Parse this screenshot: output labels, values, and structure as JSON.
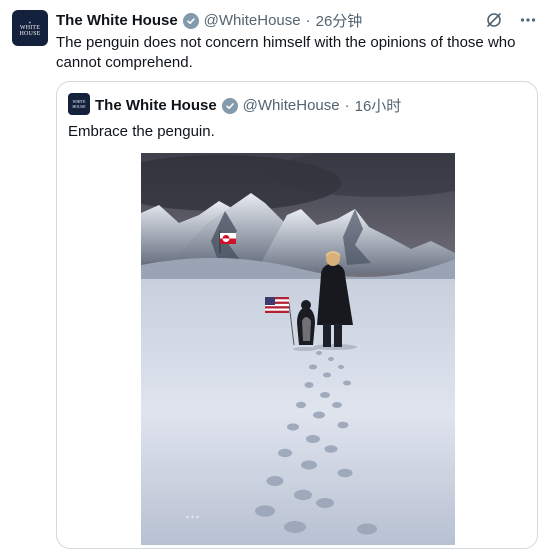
{
  "tweet": {
    "avatar_lines": [
      "WHITE",
      "HOUSE"
    ],
    "name": "The White House",
    "handle": "@WhiteHouse",
    "separator": "·",
    "time": "26分钟",
    "text": "The penguin does not concern himself with the opinions of those who cannot comprehend.",
    "icons": [
      "verified-badge-icon",
      "grok-icon",
      "more-icon"
    ]
  },
  "quote": {
    "avatar_lines": [
      "WHITE",
      "HOUSE"
    ],
    "name": "The White House",
    "handle": "@WhiteHouse",
    "separator": "·",
    "time": "16小时",
    "text": "Embrace the penguin.",
    "media_alt": "A man and a penguin walking across a snowy plain toward mountains, penguin carrying an American flag, a Greenland flag on the mountain"
  },
  "colors": {
    "text": "#0f1419",
    "secondary": "#536471",
    "border": "#cfd9de",
    "badge": "#829aab",
    "avatar_bg": "#14213d"
  }
}
